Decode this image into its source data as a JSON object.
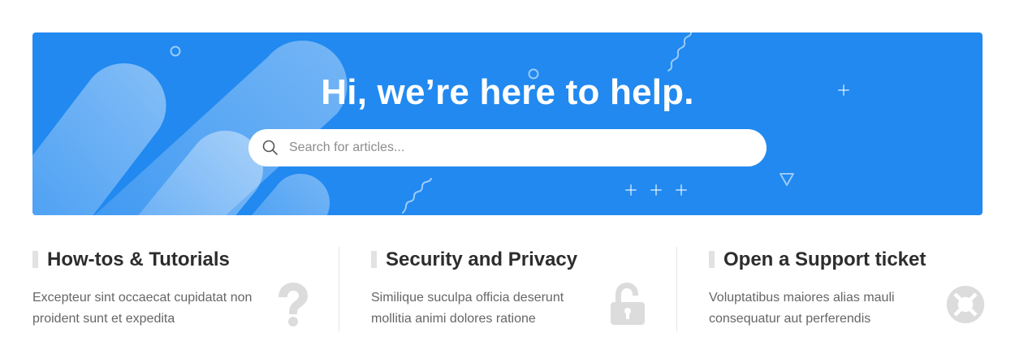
{
  "hero": {
    "title": "Hi, we’re here to help.",
    "background_color": "#2189f0",
    "search": {
      "placeholder": "Search for articles...",
      "value": "",
      "icon": "search-icon"
    }
  },
  "cards": [
    {
      "title": "How-tos & Tutorials",
      "description": "Excepteur sint occaecat cupidatat non proident sunt et expedita",
      "icon": "question-mark-icon"
    },
    {
      "title": "Security and Privacy",
      "description": "Similique suculpa officia deserunt mollitia animi dolores ratione",
      "icon": "unlocked-padlock-icon"
    },
    {
      "title": "Open a Support ticket",
      "description": "Voluptatibus maiores alias mauli consequatur aut perferendis",
      "icon": "lifebuoy-icon"
    }
  ],
  "colors": {
    "accent": "#2189f0",
    "title_text": "#2d2d2d",
    "body_text": "#666666",
    "icon_gray": "#dcdcdc"
  }
}
